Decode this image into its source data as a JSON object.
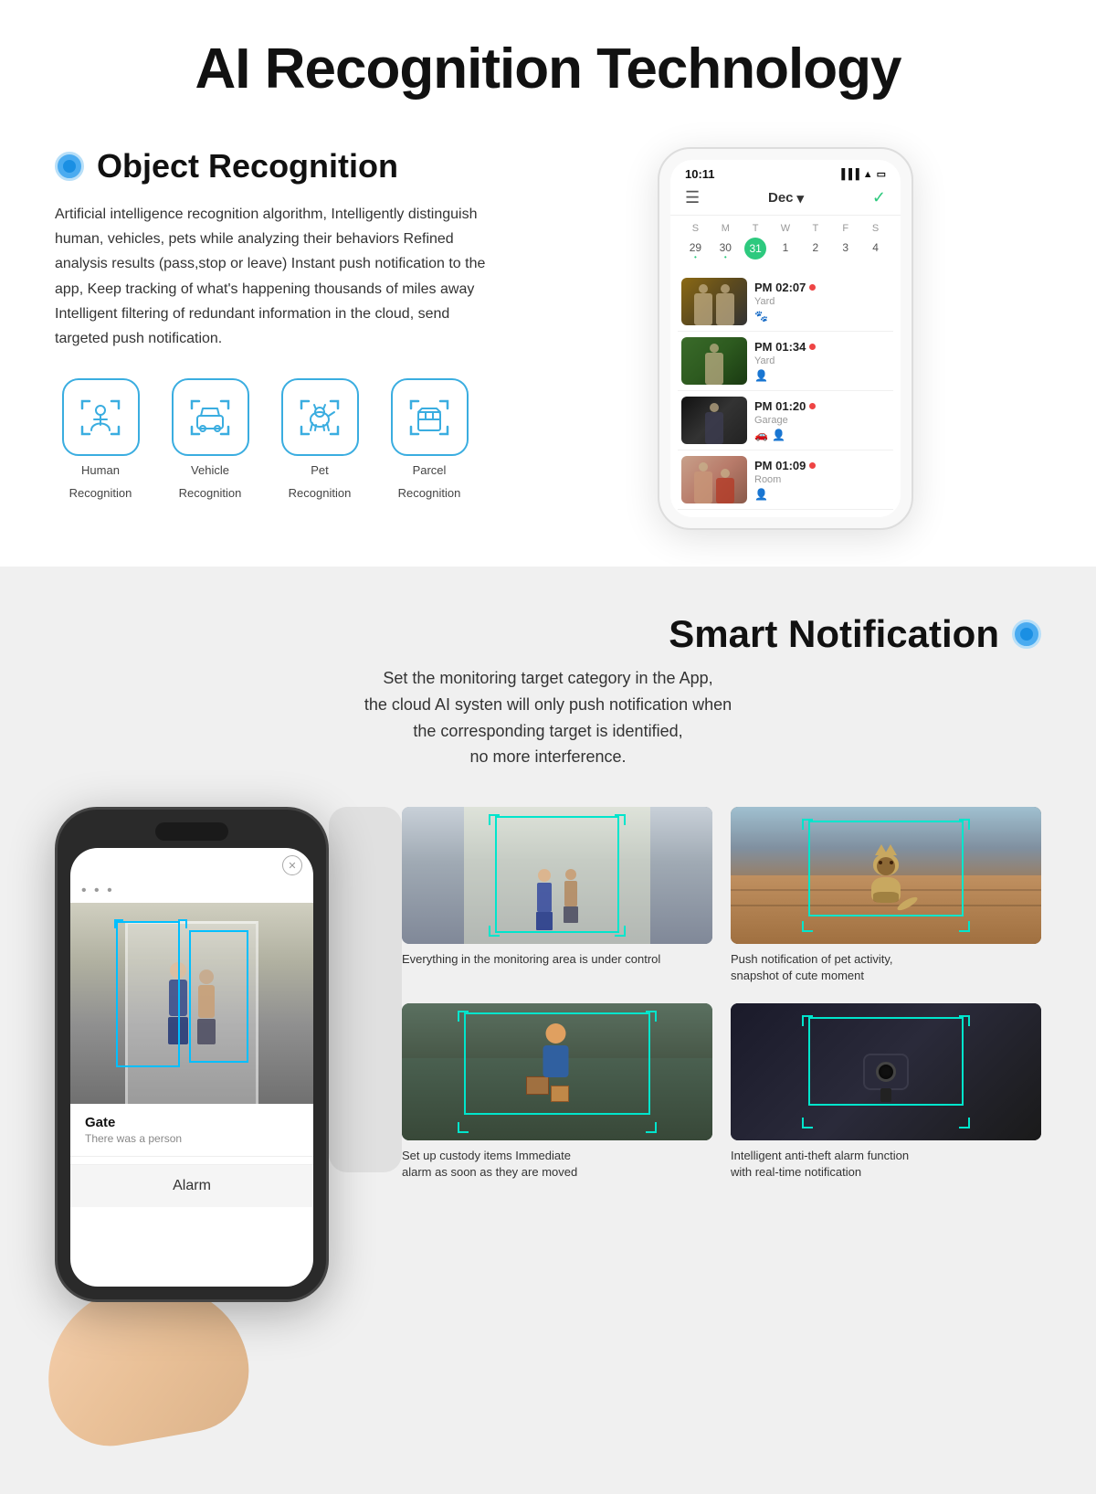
{
  "page": {
    "hero_title": "AI Recognition Technology",
    "section1": {
      "badge_dot": "blue",
      "object_recognition_title": "Object Recognition",
      "description": "Artificial intelligence recognition algorithm, Intelligently distinguish human, vehicles, pets while analyzing their behaviors Refined analysis  results (pass,stop or leave) Instant push notification to the app, Keep tracking of what's happening thousands of miles away Intelligent filtering of redundant information in the cloud, send targeted push notification.",
      "icons": [
        {
          "id": "human",
          "label": "Human\nRecognition",
          "label_line1": "Human",
          "label_line2": "Recognition"
        },
        {
          "id": "vehicle",
          "label": "Vehicle\nRecognition",
          "label_line1": "Vehicle",
          "label_line2": "Recognition"
        },
        {
          "id": "pet",
          "label": "Pet\nRecognition",
          "label_line1": "Pet",
          "label_line2": "Recognition"
        },
        {
          "id": "parcel",
          "label": "Parcel\nRecognition",
          "label_line1": "Parcel",
          "label_line2": "Recognition"
        }
      ],
      "phone": {
        "time": "10:11",
        "month": "Dec",
        "calendar_days_header": [
          "S",
          "M",
          "T",
          "W",
          "T",
          "F",
          "S"
        ],
        "calendar_days": [
          "29",
          "30",
          "31",
          "1",
          "2",
          "3",
          "4"
        ],
        "today": "31",
        "notifications": [
          {
            "time": "PM  02:07",
            "location": "Yard",
            "tags": [
              "pet"
            ]
          },
          {
            "time": "PM  01:34",
            "location": "Yard",
            "tags": [
              "person"
            ]
          },
          {
            "time": "PM  01:20",
            "location": "Garage",
            "tags": [
              "car",
              "person"
            ]
          },
          {
            "time": "PM  01:09",
            "location": "Room",
            "tags": [
              "person"
            ]
          }
        ]
      }
    },
    "section2": {
      "title": "Smart Notification",
      "subtitle": "Set the monitoring target category in the App,\nthe cloud AI systen will only push notification when\nthe corresponding target is identified,\nno more interference.",
      "phone": {
        "location": "Gate",
        "description": "There was a person",
        "alarm_button": "Alarm"
      },
      "grid_items": [
        {
          "id": "indoor-people",
          "caption": "Everything in the monitoring\narea is under control"
        },
        {
          "id": "cat",
          "caption": "Push notification of pet activity,\nsnapshot of cute moment"
        },
        {
          "id": "delivery",
          "caption": "Set up custody items Immediate\nalarm as soon as they are moved"
        },
        {
          "id": "camera-device",
          "caption": "Intelligent anti-theft alarm function\nwith real-time notification"
        }
      ]
    }
  }
}
